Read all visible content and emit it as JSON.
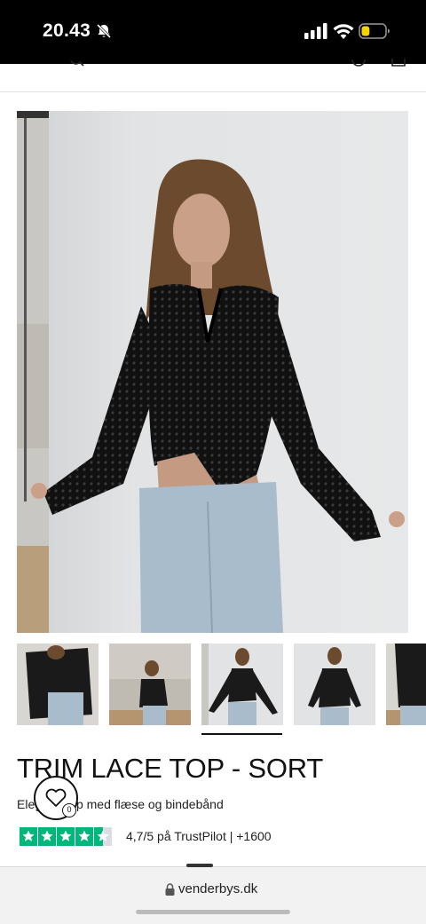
{
  "status_bar": {
    "time": "20.43",
    "icons": [
      "bell-slash-icon",
      "signal-icon",
      "wifi-icon",
      "battery-icon"
    ],
    "battery_level": 0.35,
    "battery_color": "#f5d300"
  },
  "header": {
    "icons": [
      "search-icon",
      "account-icon",
      "bag-icon"
    ]
  },
  "gallery": {
    "thumbnail_count": 5,
    "selected_index": 2
  },
  "product": {
    "title": "TRIM LACE TOP - SORT",
    "subtitle": "Eleg          ndetop med flæse og bindebånd"
  },
  "wishlist": {
    "icon": "heart-icon",
    "count": "0"
  },
  "trustpilot": {
    "stars": 4.5,
    "star_color": "#00b67a",
    "rating_text": "4,7/5 på TrustPilot | +1600"
  },
  "browser": {
    "url": "venderbys.dk",
    "icon": "lock-icon"
  }
}
